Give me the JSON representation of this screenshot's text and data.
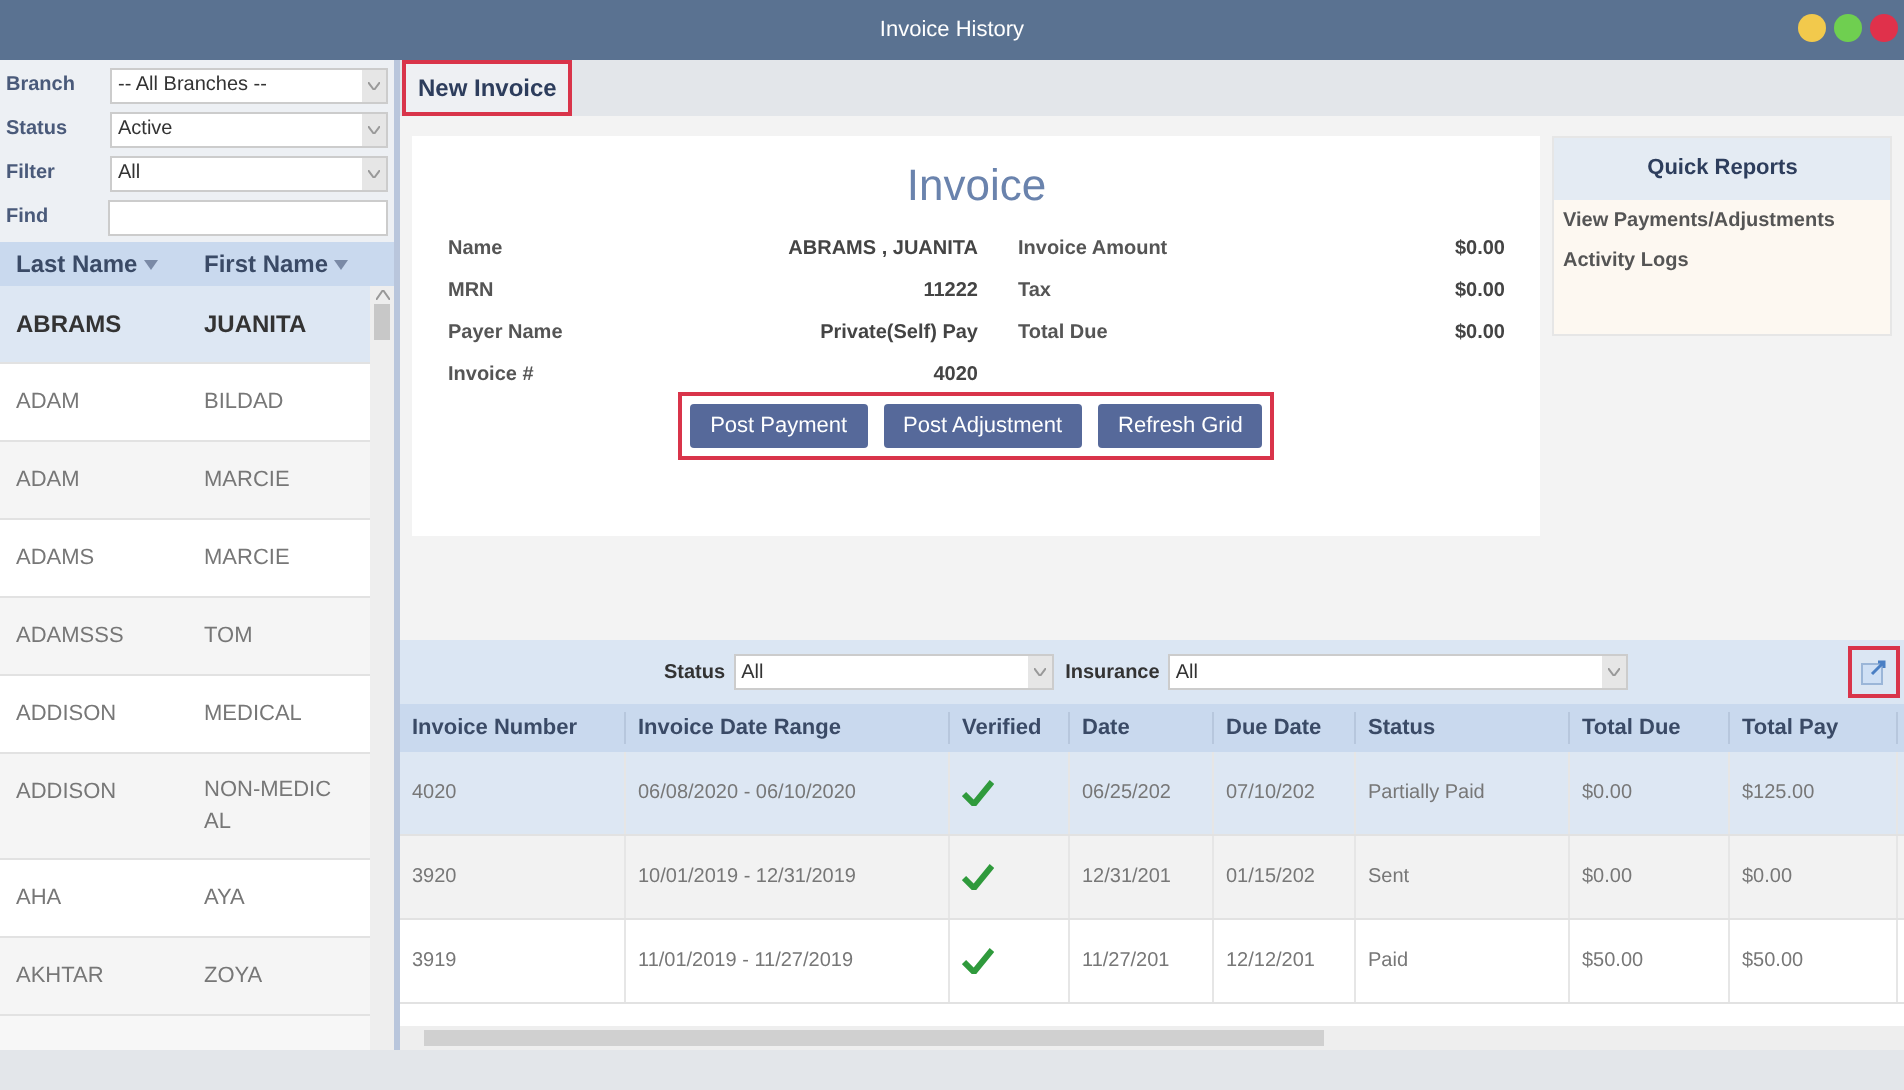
{
  "window": {
    "title": "Invoice History"
  },
  "filters": [
    {
      "label": "Branch",
      "value": "-- All Branches --",
      "kind": "dropdown"
    },
    {
      "label": "Status",
      "value": "Active",
      "kind": "dropdown"
    },
    {
      "label": "Filter",
      "value": "All",
      "kind": "dropdown"
    },
    {
      "label": "Find",
      "kind": "text"
    }
  ],
  "patients": {
    "columns": [
      "Last Name",
      "First Name"
    ],
    "rows": [
      {
        "last": "ABRAMS",
        "first": "JUANITA",
        "selected": true
      },
      {
        "last": "ADAM",
        "first": "BILDAD",
        "selected": false
      },
      {
        "last": "ADAM",
        "first": "MARCIE",
        "selected": false
      },
      {
        "last": "ADAMS",
        "first": "MARCIE",
        "selected": false
      },
      {
        "last": "ADAMSSS",
        "first": "TOM",
        "selected": false
      },
      {
        "last": "ADDISON",
        "first": "MEDICAL",
        "selected": false
      },
      {
        "last": "ADDISON",
        "first": "NON-MEDIC AL",
        "selected": false
      },
      {
        "last": "AHA",
        "first": "AYA",
        "selected": false
      },
      {
        "last": "AKHTAR",
        "first": "ZOYA",
        "selected": false
      }
    ]
  },
  "toolbar": {
    "button": "New Invoice",
    "highlighted": true
  },
  "invoice": {
    "title": "Invoice",
    "left": [
      {
        "label": "Name",
        "value": "ABRAMS , JUANITA"
      },
      {
        "label": "MRN",
        "value": "11222"
      },
      {
        "label": "Payer Name",
        "value": "Private(Self) Pay"
      },
      {
        "label": "Invoice #",
        "value": "4020"
      }
    ],
    "right": [
      {
        "label": "Invoice Amount",
        "value": "$0.00"
      },
      {
        "label": "Tax",
        "value": "$0.00"
      },
      {
        "label": "Total Due",
        "value": "$0.00"
      }
    ],
    "actions": [
      "Post Payment",
      "Post Adjustment",
      "Refresh Grid"
    ],
    "actions_highlighted": true
  },
  "quick_reports": {
    "title": "Quick Reports",
    "links": [
      "View Payments/Adjustments",
      "Activity Logs"
    ]
  },
  "grid": {
    "status_filter": {
      "label": "Status",
      "value": "All"
    },
    "insurance_filter": {
      "label": "Insurance",
      "value": "All"
    },
    "export_highlighted": true,
    "columns": [
      "Invoice Number",
      "Invoice Date Range",
      "Verified",
      "Date",
      "Due Date",
      "Status",
      "Total Due",
      "Total Pay"
    ],
    "rows": [
      {
        "number": "4020",
        "range": "06/08/2020 - 06/10/2020",
        "verified": true,
        "date": "06/25/202",
        "due": "07/10/202",
        "status": "Partially Paid",
        "total_due": "$0.00",
        "total_paid": "$125.00",
        "selected": true
      },
      {
        "number": "3920",
        "range": "10/01/2019 - 12/31/2019",
        "verified": true,
        "date": "12/31/201",
        "due": "01/15/202",
        "status": "Sent",
        "total_due": "$0.00",
        "total_paid": "$0.00",
        "selected": false
      },
      {
        "number": "3919",
        "range": "11/01/2019 - 11/27/2019",
        "verified": true,
        "date": "11/27/201",
        "due": "12/12/201",
        "status": "Paid",
        "total_due": "$50.00",
        "total_paid": "$50.00",
        "selected": false
      }
    ]
  }
}
